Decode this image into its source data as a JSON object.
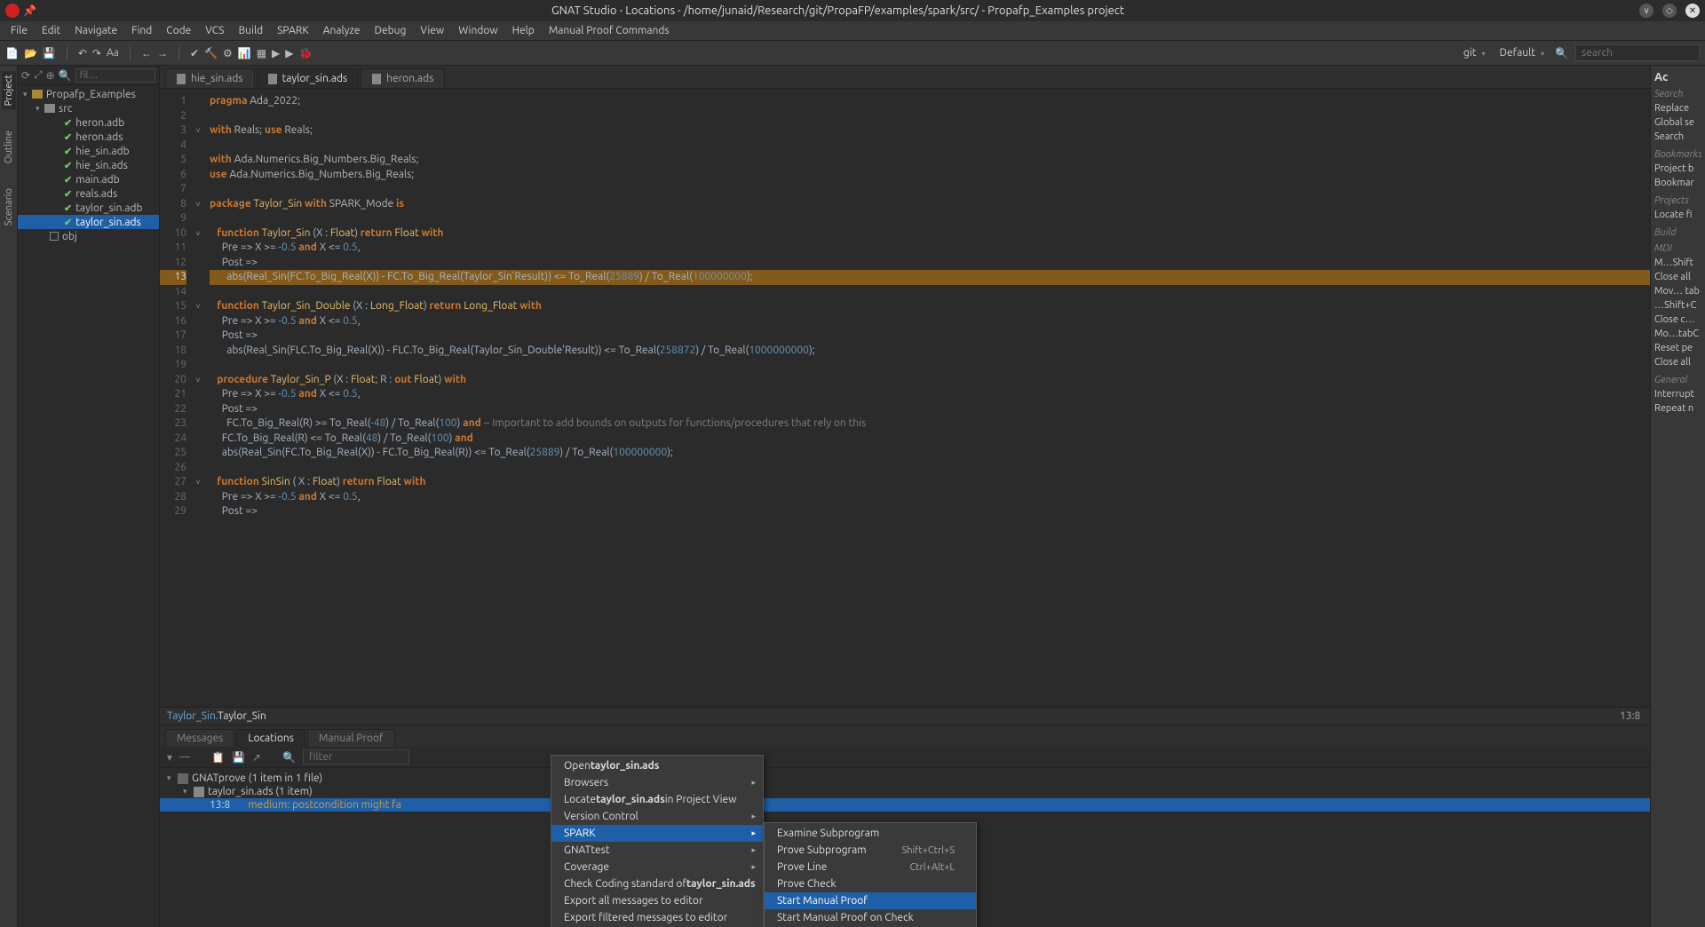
{
  "window": {
    "title": "GNAT Studio - Locations - /home/junaid/Research/git/PropaFP/examples/spark/src/ - Propafp_Examples project"
  },
  "menubar": [
    "File",
    "Edit",
    "Navigate",
    "Find",
    "Code",
    "VCS",
    "Build",
    "SPARK",
    "Analyze",
    "Debug",
    "View",
    "Window",
    "Help",
    "Manual Proof Commands"
  ],
  "toolbar": {
    "git": "git",
    "config": "Default",
    "search_placeholder": "search"
  },
  "vtabs": [
    "Project",
    "Outline",
    "Scenario"
  ],
  "project_panel": {
    "filter_placeholder": "fil…",
    "root": "Propafp_Examples",
    "src": "src",
    "files": [
      "heron.adb",
      "heron.ads",
      "hie_sin.adb",
      "hie_sin.ads",
      "main.adb",
      "reals.ads",
      "taylor_sin.adb",
      "taylor_sin.ads"
    ],
    "obj": "obj",
    "selected": "taylor_sin.ads"
  },
  "editor": {
    "tabs": [
      "hie_sin.ads",
      "taylor_sin.ads",
      "heron.ads"
    ],
    "active_tab": 1,
    "breadcrumb_parent": "Taylor_Sin.",
    "breadcrumb_current": "Taylor_Sin",
    "cursor": "13:8",
    "highlight_line": 13,
    "folds": {
      "3": true,
      "8": true,
      "10": true,
      "15": true,
      "20": true,
      "27": true
    },
    "lines": [
      {
        "n": 1,
        "t": "pragma Ada_2022;",
        "seg": [
          [
            "kw",
            "pragma"
          ],
          [
            "id",
            " Ada_2022"
          ],
          [
            "",
            ";"
          ]
        ]
      },
      {
        "n": 2,
        "t": ""
      },
      {
        "n": 3,
        "t": "with Reals; use Reals;",
        "seg": [
          [
            "kw",
            "with"
          ],
          [
            "id",
            " Reals"
          ],
          [
            "",
            "; "
          ],
          [
            "kw",
            "use"
          ],
          [
            "id",
            " Reals"
          ],
          [
            "",
            ";"
          ]
        ]
      },
      {
        "n": 4,
        "t": ""
      },
      {
        "n": 5,
        "t": "with Ada.Numerics.Big_Numbers.Big_Reals;",
        "seg": [
          [
            "kw",
            "with"
          ],
          [
            "id",
            " Ada.Numerics.Big_Numbers.Big_Reals"
          ],
          [
            "",
            ";"
          ]
        ]
      },
      {
        "n": 6,
        "t": "use Ada.Numerics.Big_Numbers.Big_Reals;",
        "seg": [
          [
            "kw",
            "use"
          ],
          [
            "id",
            " Ada.Numerics.Big_Numbers.Big_Reals"
          ],
          [
            "",
            ";"
          ]
        ]
      },
      {
        "n": 7,
        "t": ""
      },
      {
        "n": 8,
        "t": "package Taylor_Sin with SPARK_Mode is",
        "seg": [
          [
            "kw",
            "package"
          ],
          [
            "fn",
            " Taylor_Sin "
          ],
          [
            "kw",
            "with"
          ],
          [
            "id",
            " SPARK_Mode "
          ],
          [
            "kw",
            "is"
          ]
        ]
      },
      {
        "n": 9,
        "t": ""
      },
      {
        "n": 10,
        "t": "   function Taylor_Sin (X : Float) return Float with",
        "seg": [
          [
            "",
            "   "
          ],
          [
            "kw",
            "function"
          ],
          [
            "fn",
            " Taylor_Sin "
          ],
          [
            "",
            "(X : "
          ],
          [
            "fn",
            "Float"
          ],
          [
            "",
            ") "
          ],
          [
            "kw",
            "return"
          ],
          [
            "fn",
            " Float "
          ],
          [
            "kw",
            "with"
          ]
        ]
      },
      {
        "n": 11,
        "t": "     Pre => X >= -0.5 and X <= 0.5,",
        "seg": [
          [
            "",
            "     Pre => X >= "
          ],
          [
            "num",
            "-0.5"
          ],
          [
            "",
            " "
          ],
          [
            "kw",
            "and"
          ],
          [
            "",
            " X <= "
          ],
          [
            "num",
            "0.5"
          ],
          [
            "",
            ","
          ]
        ]
      },
      {
        "n": 12,
        "t": "     Post =>",
        "seg": [
          [
            "",
            "     Post =>"
          ]
        ]
      },
      {
        "n": 13,
        "t": "       abs(Real_Sin(FC.To_Big_Real(X)) - FC.To_Big_Real(Taylor_Sin'Result)) <= To_Real(25889) / To_Real(100000000);",
        "seg": [
          [
            "",
            "       abs(Real_Sin(FC.To_Big_Real(X)) - FC.To_Big_Real(Taylor_Sin'Result)) <= To_Real("
          ],
          [
            "num",
            "25889"
          ],
          [
            "",
            ") / To_Real("
          ],
          [
            "num",
            "100000000"
          ],
          [
            "",
            ");"
          ]
        ]
      },
      {
        "n": 14,
        "t": ""
      },
      {
        "n": 15,
        "t": "   function Taylor_Sin_Double (X : Long_Float) return Long_Float with",
        "seg": [
          [
            "",
            "   "
          ],
          [
            "kw",
            "function"
          ],
          [
            "fn",
            " Taylor_Sin_Double "
          ],
          [
            "",
            "(X : "
          ],
          [
            "fn",
            "Long_Float"
          ],
          [
            "",
            ") "
          ],
          [
            "kw",
            "return"
          ],
          [
            "fn",
            " Long_Float "
          ],
          [
            "kw",
            "with"
          ]
        ]
      },
      {
        "n": 16,
        "t": "     Pre => X >= -0.5 and X <= 0.5,",
        "seg": [
          [
            "",
            "     Pre => X >= "
          ],
          [
            "num",
            "-0.5"
          ],
          [
            "",
            " "
          ],
          [
            "kw",
            "and"
          ],
          [
            "",
            " X <= "
          ],
          [
            "num",
            "0.5"
          ],
          [
            "",
            ","
          ]
        ]
      },
      {
        "n": 17,
        "t": "     Post =>",
        "seg": [
          [
            "",
            "     Post =>"
          ]
        ]
      },
      {
        "n": 18,
        "t": "       abs(Real_Sin(FLC.To_Big_Real(X)) - FLC.To_Big_Real(Taylor_Sin_Double'Result)) <= To_Real(258872) / To_Real(1000000000);",
        "seg": [
          [
            "",
            "       abs(Real_Sin(FLC.To_Big_Real(X)) - FLC.To_Big_Real(Taylor_Sin_Double'Result)) <= To_Real("
          ],
          [
            "num",
            "258872"
          ],
          [
            "",
            ") / To_Real("
          ],
          [
            "num",
            "1000000000"
          ],
          [
            "",
            ");"
          ]
        ]
      },
      {
        "n": 19,
        "t": ""
      },
      {
        "n": 20,
        "t": "   procedure Taylor_Sin_P (X : Float; R : out Float) with",
        "seg": [
          [
            "",
            "   "
          ],
          [
            "kw",
            "procedure"
          ],
          [
            "fn",
            " Taylor_Sin_P "
          ],
          [
            "",
            "(X : "
          ],
          [
            "fn",
            "Float"
          ],
          [
            "",
            "; R : "
          ],
          [
            "kw",
            "out"
          ],
          [
            "fn",
            " Float"
          ],
          [
            "",
            ") "
          ],
          [
            "kw",
            "with"
          ]
        ]
      },
      {
        "n": 21,
        "t": "     Pre => X >= -0.5 and X <= 0.5,",
        "seg": [
          [
            "",
            "     Pre => X >= "
          ],
          [
            "num",
            "-0.5"
          ],
          [
            "",
            " "
          ],
          [
            "kw",
            "and"
          ],
          [
            "",
            " X <= "
          ],
          [
            "num",
            "0.5"
          ],
          [
            "",
            ","
          ]
        ]
      },
      {
        "n": 22,
        "t": "     Post =>",
        "seg": [
          [
            "",
            "     Post =>"
          ]
        ]
      },
      {
        "n": 23,
        "t": "       FC.To_Big_Real(R) >= To_Real(-48) / To_Real(100) and -- Important to add bounds on outputs for functions/procedures that rely on this",
        "seg": [
          [
            "",
            "       FC.To_Big_Real(R) >= To_Real("
          ],
          [
            "num",
            "-48"
          ],
          [
            "",
            ") / To_Real("
          ],
          [
            "num",
            "100"
          ],
          [
            "",
            ") "
          ],
          [
            "kw",
            "and"
          ],
          [
            "",
            " "
          ],
          [
            "cmt",
            "-- Important to add bounds on outputs for functions/procedures that rely on this"
          ]
        ]
      },
      {
        "n": 24,
        "t": "     FC.To_Big_Real(R) <= To_Real(48) / To_Real(100) and",
        "seg": [
          [
            "",
            "     FC.To_Big_Real(R) <= To_Real("
          ],
          [
            "num",
            "48"
          ],
          [
            "",
            ") / To_Real("
          ],
          [
            "num",
            "100"
          ],
          [
            "",
            ") "
          ],
          [
            "kw",
            "and"
          ]
        ]
      },
      {
        "n": 25,
        "t": "     abs(Real_Sin(FC.To_Big_Real(X)) - FC.To_Big_Real(R)) <= To_Real(25889) / To_Real(100000000);",
        "seg": [
          [
            "",
            "     abs(Real_Sin(FC.To_Big_Real(X)) - FC.To_Big_Real(R)) <= To_Real("
          ],
          [
            "num",
            "25889"
          ],
          [
            "",
            ") / To_Real("
          ],
          [
            "num",
            "100000000"
          ],
          [
            "",
            ");"
          ]
        ]
      },
      {
        "n": 26,
        "t": ""
      },
      {
        "n": 27,
        "t": "   function SinSin ( X : Float) return Float with",
        "seg": [
          [
            "",
            "   "
          ],
          [
            "kw",
            "function"
          ],
          [
            "fn",
            " SinSin "
          ],
          [
            "",
            "( X : "
          ],
          [
            "fn",
            "Float"
          ],
          [
            "",
            ") "
          ],
          [
            "kw",
            "return"
          ],
          [
            "fn",
            " Float "
          ],
          [
            "kw",
            "with"
          ]
        ]
      },
      {
        "n": 28,
        "t": "     Pre => X >= -0.5 and X <= 0.5,",
        "seg": [
          [
            "",
            "     Pre => X >= "
          ],
          [
            "num",
            "-0.5"
          ],
          [
            "",
            " "
          ],
          [
            "kw",
            "and"
          ],
          [
            "",
            " X <= "
          ],
          [
            "num",
            "0.5"
          ],
          [
            "",
            ","
          ]
        ]
      },
      {
        "n": 29,
        "t": "     Post =>",
        "seg": [
          [
            "",
            "     Post =>"
          ]
        ]
      }
    ]
  },
  "bottom": {
    "tabs": [
      "Messages",
      "Locations",
      "Manual Proof"
    ],
    "active": 1,
    "filter_placeholder": "filter",
    "root": "GNATprove (1 item in 1 file)",
    "file": "taylor_sin.ads (1 item)",
    "item_loc": "13:8",
    "item_msg": "medium: postcondition might fa"
  },
  "ctx1": {
    "items": [
      {
        "label": "Open ",
        "bold": "taylor_sin.ads"
      },
      {
        "label": "Browsers",
        "sub": true
      },
      {
        "label": "Locate ",
        "bold": "taylor_sin.ads",
        "tail": " in Project View"
      },
      {
        "label": "Version Control",
        "sub": true
      },
      {
        "label": "SPARK",
        "sub": true,
        "sel": true
      },
      {
        "label": "GNATtest",
        "sub": true
      },
      {
        "label": "Coverage",
        "sub": true
      },
      {
        "label": "Check Coding standard of ",
        "bold": "taylor_sin.ads"
      },
      {
        "label": "Export all messages to editor"
      },
      {
        "label": "Export filtered messages to editor"
      }
    ]
  },
  "ctx2": {
    "items": [
      {
        "label": "Examine Subprogram"
      },
      {
        "label": "Prove Subprogram",
        "kb": "Shift+Ctrl+S"
      },
      {
        "label": "Prove Line",
        "kb": "Ctrl+Alt+L"
      },
      {
        "label": "Prove Check"
      },
      {
        "label": "Start Manual Proof",
        "sel": true
      },
      {
        "label": "Start Manual Proof on Check"
      }
    ]
  },
  "right": {
    "title": "Ac",
    "groups": [
      {
        "h": "Search",
        "items": [
          "Replace",
          "Global se",
          "Search"
        ]
      },
      {
        "h": "Bookmarks",
        "items": [
          "Project b",
          "Bookmar"
        ]
      },
      {
        "h": "Projects",
        "items": [
          "Locate fi"
        ]
      },
      {
        "h": "Build",
        "items": []
      },
      {
        "h": "MDI",
        "items": [
          "M…Shift",
          "Close all",
          "Mov… tab",
          "…Shift+C",
          "Close c…",
          "Mo…tabC",
          "Reset pe",
          "Close all"
        ]
      },
      {
        "h": "General",
        "items": [
          "Interrupt",
          "Repeat n"
        ]
      }
    ]
  }
}
